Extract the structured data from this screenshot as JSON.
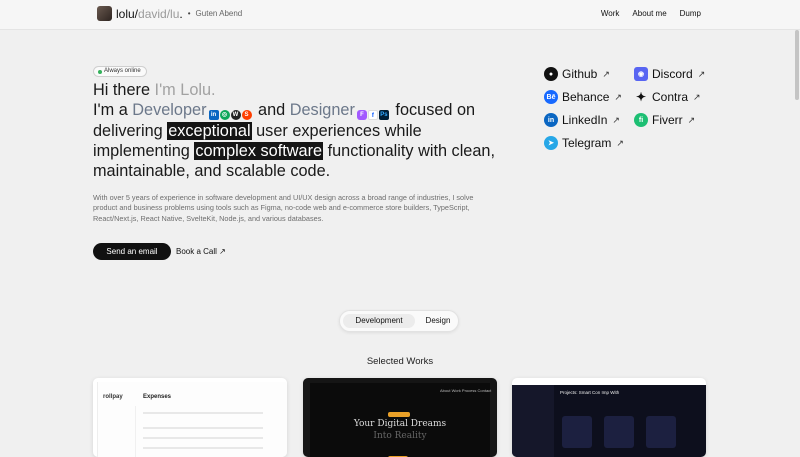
{
  "header": {
    "logo_primary": "lolu/",
    "logo_muted": "david/lu",
    "logo_dot": ".",
    "separator": "•",
    "greeting": "Guten Abend",
    "nav": [
      "Work",
      "About me",
      "Dump"
    ]
  },
  "hero": {
    "status_badge": "Always online",
    "intro_a": "Hi there ",
    "intro_b": "I'm Lolu.",
    "im_a": "I'm a ",
    "developer": "Developer",
    "and": " and ",
    "designer": "Designer",
    "focused_on": " focused on delivering ",
    "exceptional": "exceptional",
    "ux_text": " user experiences while implementing ",
    "complex": "complex software",
    "func_text": " functionality with clean, maintainable, and scalable code.",
    "developer_tools": [
      {
        "icon": "linkedin-icon",
        "glyph": "in"
      },
      {
        "icon": "graphql-icon",
        "glyph": "◎"
      },
      {
        "icon": "webflow-icon",
        "glyph": "W"
      },
      {
        "icon": "svelte-icon",
        "glyph": "S"
      }
    ],
    "designer_tools": [
      {
        "icon": "figma-icon",
        "glyph": "F"
      },
      {
        "icon": "framer-icon",
        "glyph": "f"
      },
      {
        "icon": "photoshop-icon",
        "glyph": "Ps"
      }
    ],
    "paragraph": "With over 5 years of experience in software development and UI/UX design across a broad range of industries, I solve product and business problems using tools such as Figma, no-code web and e-commerce store builders, TypeScript, React/Next.js, React Native, SvelteKit, Node.js, and various databases.",
    "primary_button": "Send an email",
    "secondary_link": "Book a Call ↗"
  },
  "socials": [
    {
      "label": "Github",
      "icon": "github-icon",
      "color": "#111111",
      "glyph": "●"
    },
    {
      "label": "Discord",
      "icon": "discord-icon",
      "color": "#5865F2",
      "glyph": "◉"
    },
    {
      "label": "Behance",
      "icon": "behance-icon",
      "color": "#1769ff",
      "glyph": "Bē"
    },
    {
      "label": "Contra",
      "icon": "contra-icon",
      "color": "#111111",
      "glyph": "✦"
    },
    {
      "label": "LinkedIn",
      "icon": "linkedin-icon",
      "color": "#0a66c2",
      "glyph": "in"
    },
    {
      "label": "Fiverr",
      "icon": "fiverr-icon",
      "color": "#1dbf73",
      "glyph": "fi"
    },
    {
      "label": "Telegram",
      "icon": "telegram-icon",
      "color": "#27a7e7",
      "glyph": "➤"
    }
  ],
  "social_arrow": "↗",
  "toggle": {
    "active": "Development",
    "inactive": "Design"
  },
  "works": {
    "title": "Selected Works",
    "card1": {
      "logo": "rollpay",
      "title": "Expenses"
    },
    "card2": {
      "title_line1": "Your Digital Dreams",
      "title_line2": "Into Reality",
      "nav": "About   Work   Process   Contact"
    },
    "card3": {
      "title": "Projects: Smart Con Imp With"
    }
  },
  "colors": {
    "accent_dark": "#111111",
    "online_green": "#33b15a",
    "developer_color": "#6c788a",
    "muted_text": "#a2a2a2"
  }
}
